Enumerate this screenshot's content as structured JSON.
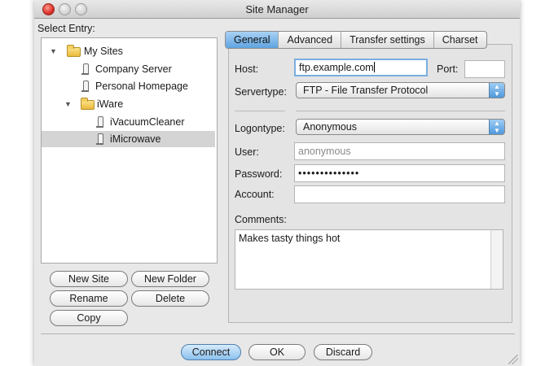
{
  "window": {
    "title": "Site Manager"
  },
  "sidebar": {
    "label": "Select Entry:",
    "tree": [
      {
        "label": "My Sites",
        "type": "folder",
        "expanded": true
      },
      {
        "label": "Company Server",
        "type": "site"
      },
      {
        "label": "Personal Homepage",
        "type": "site"
      },
      {
        "label": "iWare",
        "type": "folder",
        "expanded": true
      },
      {
        "label": "iVacuumCleaner",
        "type": "site"
      },
      {
        "label": "iMicrowave",
        "type": "site",
        "selected": true
      }
    ],
    "buttons": {
      "new_site": "New Site",
      "new_folder": "New Folder",
      "rename": "Rename",
      "delete": "Delete",
      "copy": "Copy"
    }
  },
  "tabs": [
    {
      "label": "General",
      "active": true
    },
    {
      "label": "Advanced"
    },
    {
      "label": "Transfer settings"
    },
    {
      "label": "Charset"
    }
  ],
  "general": {
    "host_label": "Host:",
    "host_value": "ftp.example.com",
    "port_label": "Port:",
    "port_value": "",
    "servertype_label": "Servertype:",
    "servertype_value": "FTP - File Transfer Protocol",
    "logontype_label": "Logontype:",
    "logontype_value": "Anonymous",
    "user_label": "User:",
    "user_value": "anonymous",
    "password_label": "Password:",
    "password_value": "••••••••••••••",
    "account_label": "Account:",
    "account_value": "",
    "comments_label": "Comments:",
    "comments_value": "Makes tasty things hot"
  },
  "footer": {
    "connect": "Connect",
    "ok": "OK",
    "discard": "Discard"
  },
  "colors": {
    "accent": "#5fa4e0",
    "selection": "#d4d4d4"
  }
}
